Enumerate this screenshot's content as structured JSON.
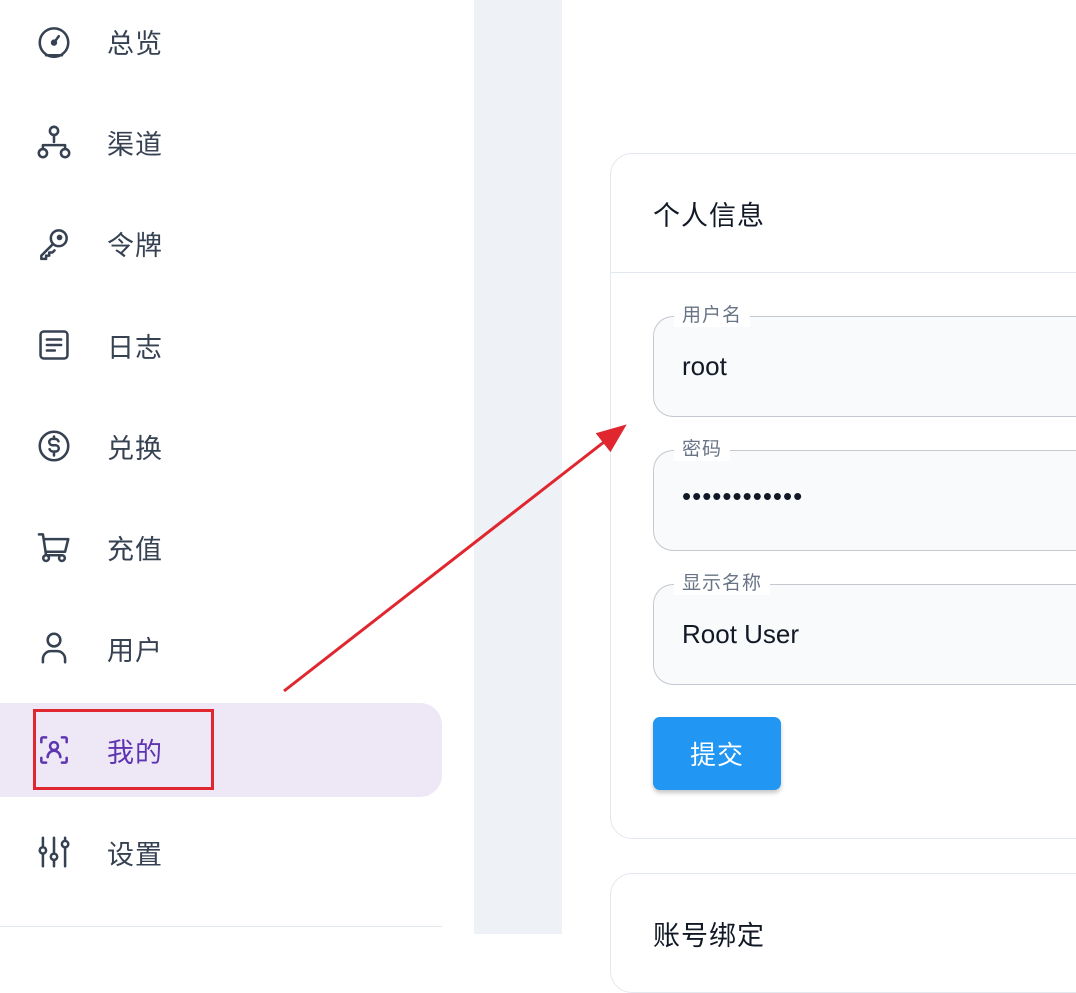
{
  "sidebar": {
    "items": [
      {
        "label": "总览",
        "icon": "dashboard-gauge-icon"
      },
      {
        "label": "渠道",
        "icon": "sitemap-icon"
      },
      {
        "label": "令牌",
        "icon": "key-icon"
      },
      {
        "label": "日志",
        "icon": "article-icon"
      },
      {
        "label": "兑换",
        "icon": "dollar-circle-icon"
      },
      {
        "label": "充值",
        "icon": "shopping-cart-icon"
      },
      {
        "label": "用户",
        "icon": "user-icon"
      },
      {
        "label": "我的",
        "icon": "user-scan-icon",
        "active": true
      },
      {
        "label": "设置",
        "icon": "adjustments-icon"
      }
    ]
  },
  "profile_card": {
    "title": "个人信息",
    "fields": [
      {
        "legend": "用户名",
        "value": "root"
      },
      {
        "legend": "密码",
        "value": "••••••••••••"
      },
      {
        "legend": "显示名称",
        "value": "Root User"
      }
    ],
    "submit_label": "提交"
  },
  "binding_card": {
    "title": "账号绑定"
  },
  "colors": {
    "accent": "#5e35b1",
    "active_bg": "#ede7f6",
    "primary_button": "#2196f3",
    "annotation_red": "#e0262e"
  }
}
